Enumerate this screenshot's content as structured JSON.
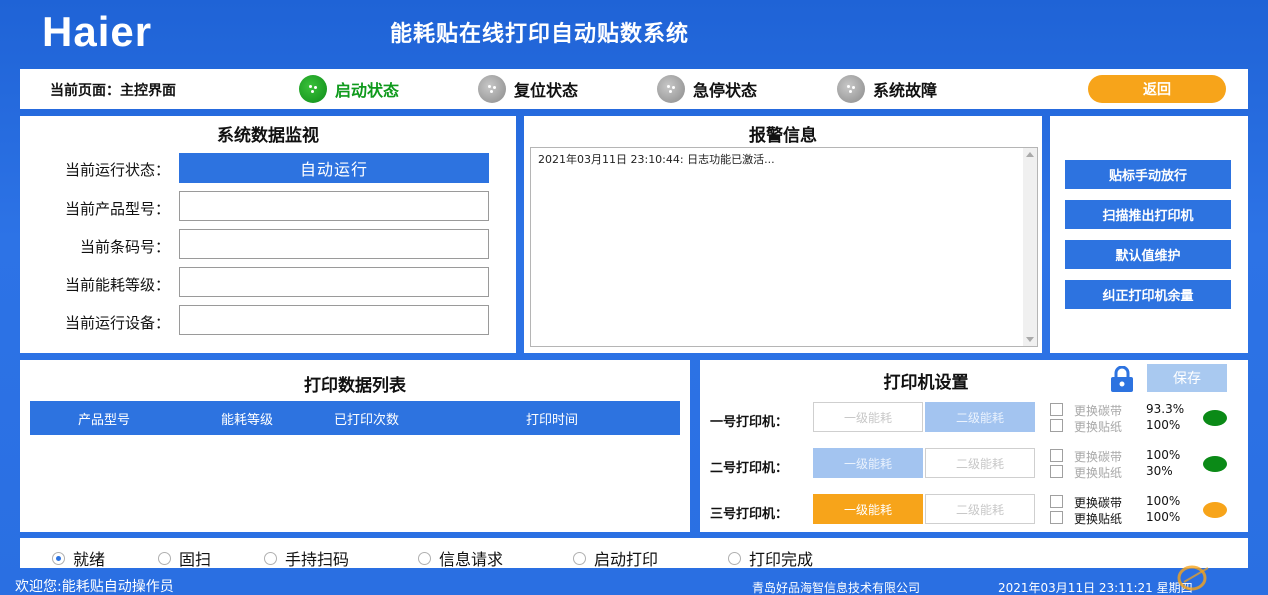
{
  "header": {
    "logo": "Haier",
    "title": "能耗贴在线打印自动贴数系统"
  },
  "statusbar": {
    "page_label": "当前页面：主控界面",
    "indicators": [
      {
        "label": "启动状态",
        "state": "on",
        "color": "#0f9a1c"
      },
      {
        "label": "复位状态",
        "state": "off",
        "color": "#8a8a8a"
      },
      {
        "label": "急停状态",
        "state": "off",
        "color": "#8a8a8a"
      },
      {
        "label": "系统故障",
        "state": "off",
        "color": "#8a8a8a"
      }
    ],
    "back_label": "返回"
  },
  "monitor": {
    "title": "系统数据监视",
    "fields": [
      {
        "label": "当前运行状态：",
        "value": "自动运行"
      },
      {
        "label": "当前产品型号：",
        "value": ""
      },
      {
        "label": "当前条码号：",
        "value": ""
      },
      {
        "label": "当前能耗等级：",
        "value": ""
      },
      {
        "label": "当前运行设备：",
        "value": ""
      }
    ]
  },
  "alarm": {
    "title": "报警信息",
    "lines": [
      "2021年03月11日 23:10:44: 日志功能已激活..."
    ]
  },
  "side_buttons": [
    "贴标手动放行",
    "扫描推出打印机",
    "默认值维护",
    "纠正打印机余量"
  ],
  "print_list": {
    "title": "打印数据列表",
    "columns": [
      "产品型号",
      "能耗等级",
      "已打印次数",
      "打印时间"
    ]
  },
  "printer_settings": {
    "title": "打印机设置",
    "save_label": "保存",
    "level1_label": "一级能耗",
    "level2_label": "二级能耗",
    "ribbon_label": "更换碳带",
    "paper_label": "更换贴纸",
    "printers": [
      {
        "label": "一号打印机：",
        "selected": "level2",
        "ribbon": "93.3%",
        "paper": "100%",
        "status_color": "#0b8a17"
      },
      {
        "label": "二号打印机：",
        "selected": "level1",
        "ribbon": "100%",
        "paper": "30%",
        "status_color": "#0b8a17"
      },
      {
        "label": "三号打印机：",
        "selected": "level1-active",
        "ribbon": "100%",
        "paper": "100%",
        "status_color": "#f7a41a"
      }
    ]
  },
  "modes": {
    "selected": 0,
    "items": [
      "就绪",
      "固扫",
      "手持扫码",
      "信息请求",
      "启动打印",
      "打印完成"
    ]
  },
  "footer": {
    "welcome": "欢迎您:能耗贴自动操作员",
    "company": "青岛好品海智信息技术有限公司",
    "datetime": "2021年03月11日 23:11:21 星期四"
  },
  "colors": {
    "primary": "#2d73e0",
    "accent": "#f7a41a",
    "ok": "#0f9a1c"
  }
}
